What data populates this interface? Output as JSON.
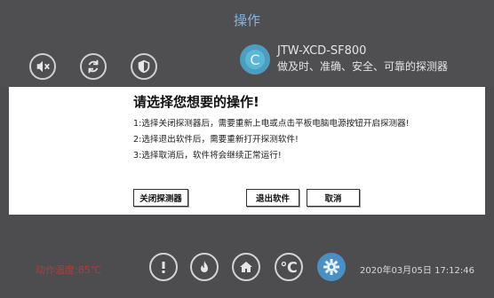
{
  "header": {
    "title": "操作",
    "brand_model": "JTW-XCD-SF800",
    "brand_slogan": "做及时、准确、安全、可靠的探测器",
    "logo_letter": "C",
    "icons": [
      "mute-icon",
      "refresh-icon",
      "shield-icon"
    ]
  },
  "dialog": {
    "title": "请选择您想要的操作!",
    "lines": [
      "1:选择关闭探测器后，需要重新上电或点击平板电脑电源按钮开启探测器!",
      "2:选择退出软件后，需要重新打开探测软件!",
      "3:选择取消后，软件将会继续正常运行!"
    ],
    "buttons": {
      "close_detector": "关闭探测器",
      "exit_software": "退出软件",
      "cancel": "取消"
    }
  },
  "footer": {
    "temperature": "动作温度:85℃",
    "celsius_label": "℃",
    "datetime": "2020年03月05日 17:12:46",
    "icons": [
      "alert-icon",
      "flame-icon",
      "home-icon",
      "celsius-icon",
      "settings-icon"
    ]
  },
  "colors": {
    "background": "#4d4d4f",
    "title": "#7fb6de",
    "temperature": "#b33a3a",
    "accent": "#4a90c4"
  }
}
